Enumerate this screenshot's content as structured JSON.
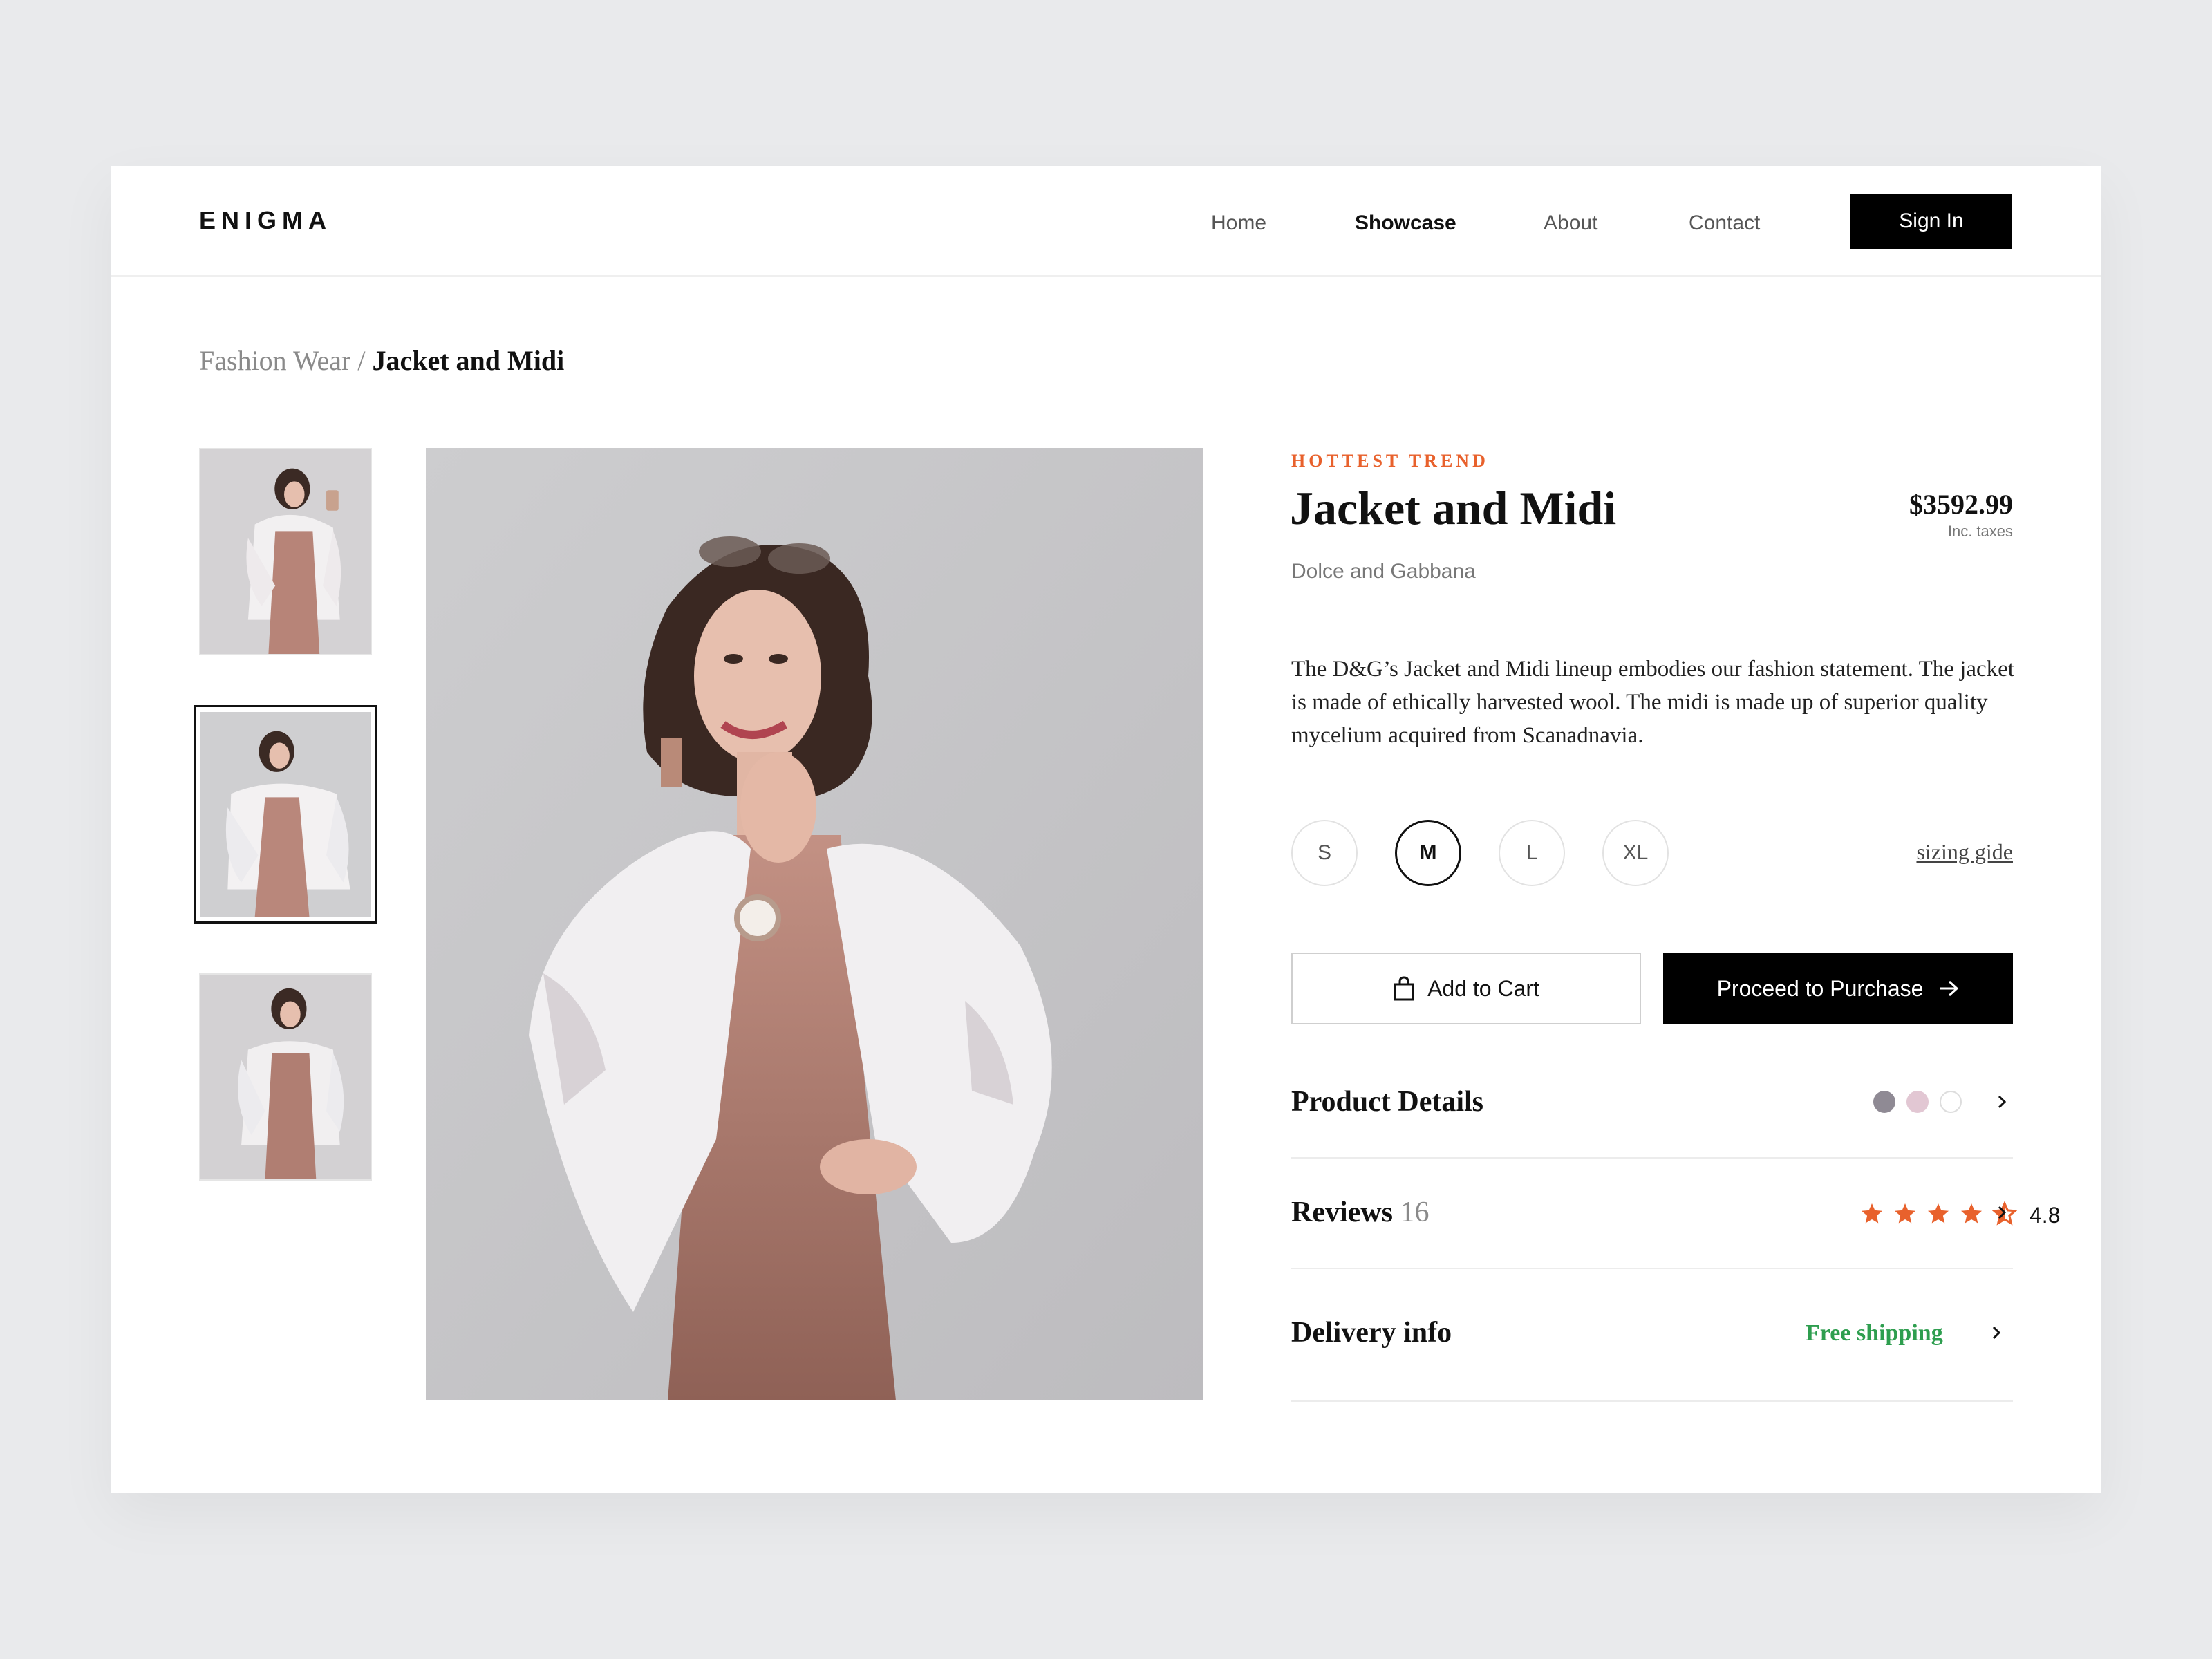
{
  "nav": {
    "logo": "ENIGMA",
    "links": [
      "Home",
      "Showcase",
      "About",
      "Contact"
    ],
    "active": "Showcase",
    "signin": "Sign In"
  },
  "breadcrumb": {
    "parent": "Fashion Wear /",
    "current": "Jacket and Midi"
  },
  "product": {
    "eyebrow": "HOTTEST TREND",
    "title": "Jacket and Midi",
    "price": "$3592.99",
    "tax_note": "Inc. taxes",
    "brand": "Dolce and Gabbana",
    "description": "The D&G’s Jacket and Midi lineup embodies our fashion statement. The jacket is made of ethically harvested wool.  The midi is made up of superior quality mycelium acquired from Scanadnavia.",
    "sizes": [
      "S",
      "M",
      "L",
      "XL"
    ],
    "selected_size": "M",
    "sizing_link": "sizing gide"
  },
  "actions": {
    "cart": "Add to Cart",
    "purchase": "Proceed to Purchase"
  },
  "details": {
    "product_details": "Product Details",
    "colors": [
      "#8f8a94",
      "#e2c7d3",
      "#ffffff"
    ],
    "reviews_label": "Reviews",
    "reviews_count": "16",
    "rating_value": 4.8,
    "rating_text": "4.8",
    "delivery_label": "Delivery info",
    "delivery_value": "Free shipping"
  },
  "colors": {
    "accent": "#e8612c",
    "success": "#2e9e4f",
    "primary": "#000000"
  },
  "icons": [
    "bag-icon",
    "arrow-right-icon",
    "chevron-right-icon",
    "star-icon"
  ]
}
